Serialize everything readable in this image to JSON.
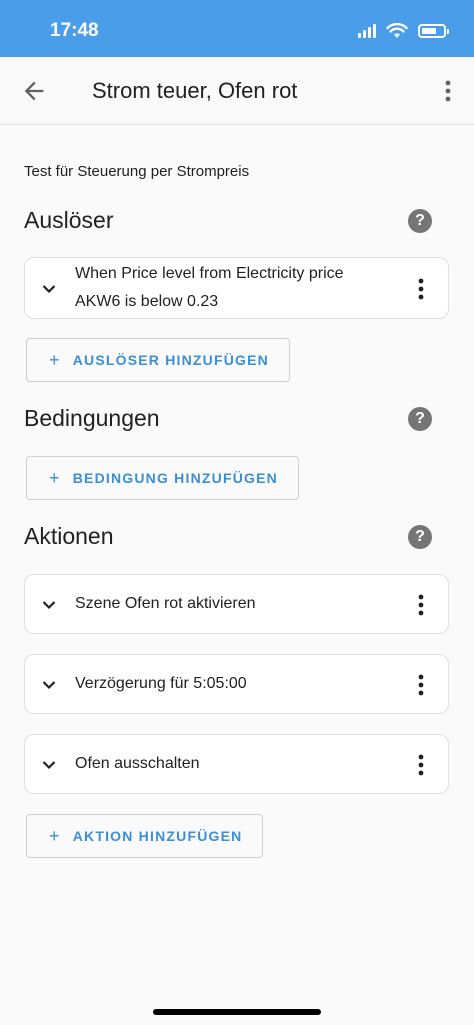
{
  "status_bar": {
    "time": "17:48"
  },
  "app_bar": {
    "title": "Strom teuer, Ofen rot",
    "back_icon": "arrow-left-icon",
    "menu_icon": "more-vert-icon"
  },
  "description": "Test für Steuerung per Strompreis",
  "triggers": {
    "title": "Auslöser",
    "help_icon": "help-circle-icon",
    "items": [
      {
        "line1": "When Price level from Electricity price",
        "line2": "AKW6 is below 0.23"
      }
    ],
    "add_label": "AUSLÖSER HINZUFÜGEN"
  },
  "conditions": {
    "title": "Bedingungen",
    "help_icon": "help-circle-icon",
    "add_label": "BEDINGUNG HINZUFÜGEN"
  },
  "actions": {
    "title": "Aktionen",
    "help_icon": "help-circle-icon",
    "items": [
      {
        "label": "Szene Ofen rot aktivieren"
      },
      {
        "label": "Verzögerung für 5:05:00"
      },
      {
        "label": "Ofen ausschalten"
      }
    ],
    "add_label": "AKTION HINZUFÜGEN"
  },
  "colors": {
    "status_bar": "#4a9de8",
    "accent": "#3a8fd6",
    "help_icon": "#757575"
  }
}
